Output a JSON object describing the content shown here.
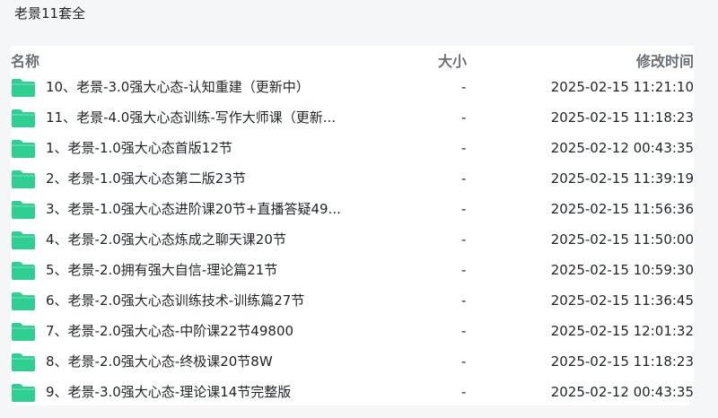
{
  "folder_title": "老景11套全",
  "columns": {
    "name": "名称",
    "size": "大小",
    "time": "修改时间"
  },
  "colors": {
    "folder_icon": "#2fcf94"
  },
  "items": [
    {
      "icon": "folder-icon",
      "name": "10、老景-3.0强大心态-认知重建（更新中）",
      "size": "-",
      "time": "2025-02-15 11:21:10"
    },
    {
      "icon": "folder-icon",
      "name": "11、老景-4.0强大心态训练-写作大师课（更新...",
      "size": "-",
      "time": "2025-02-15 11:18:23"
    },
    {
      "icon": "folder-icon",
      "name": "1、老景-1.0强大心态首版12节",
      "size": "-",
      "time": "2025-02-12 00:43:35"
    },
    {
      "icon": "folder-icon",
      "name": "2、老景-1.0强大心态第二版23节",
      "size": "-",
      "time": "2025-02-15 11:39:19"
    },
    {
      "icon": "folder-icon",
      "name": "3、老景-1.0强大心态进阶课20节+直播答疑49...",
      "size": "-",
      "time": "2025-02-15 11:56:36"
    },
    {
      "icon": "folder-icon",
      "name": "4、老景-2.0强大心态炼成之聊天课20节",
      "size": "-",
      "time": "2025-02-15 11:50:00"
    },
    {
      "icon": "folder-icon",
      "name": "5、老景-2.0拥有强大自信-理论篇21节",
      "size": "-",
      "time": "2025-02-15 10:59:30"
    },
    {
      "icon": "folder-icon",
      "name": "6、老景-2.0强大心态训练技术-训练篇27节",
      "size": "-",
      "time": "2025-02-15 11:36:45"
    },
    {
      "icon": "folder-icon",
      "name": "7、老景-2.0强大心态-中阶课22节49800",
      "size": "-",
      "time": "2025-02-15 12:01:32"
    },
    {
      "icon": "folder-icon",
      "name": "8、老景-2.0强大心态-终极课20节8W",
      "size": "-",
      "time": "2025-02-15 11:18:23"
    },
    {
      "icon": "folder-icon",
      "name": "9、老景-3.0强大心态-理论课14节完整版",
      "size": "-",
      "time": "2025-02-12 00:43:35"
    }
  ]
}
